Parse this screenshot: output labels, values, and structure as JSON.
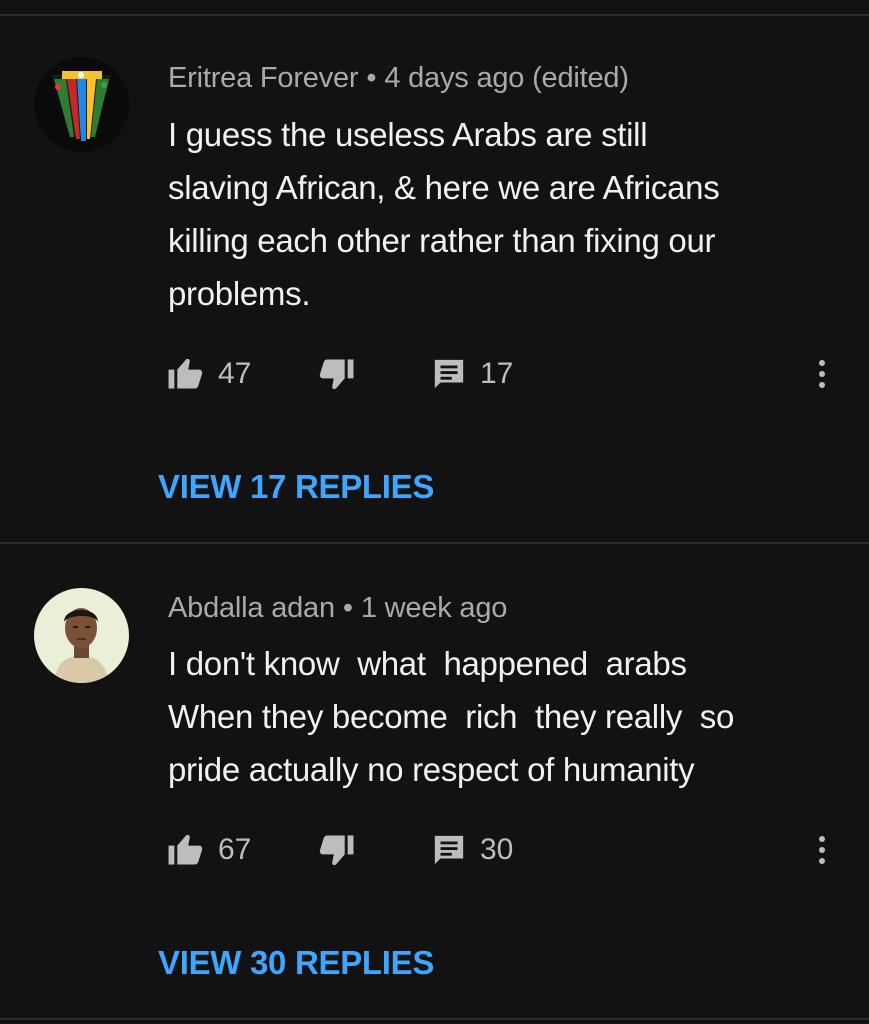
{
  "comments": [
    {
      "author": "Eritrea Forever",
      "separator": "•",
      "time": "4 days ago (edited)",
      "text": "I guess the useless Arabs are still\nslaving African, & here we are Africans\nkilling each other rather than fixing our\nproblems.",
      "likes": "47",
      "reply_count": "17",
      "view_replies": "VIEW 17 REPLIES",
      "avatar_icon": "flag-fan-avatar"
    },
    {
      "author": "Abdalla adan",
      "separator": "•",
      "time": "1 week ago",
      "text": "I don't know  what  happened  arabs\nWhen they become  rich  they really  so\npride actually no respect of humanity",
      "likes": "67",
      "reply_count": "30",
      "view_replies": "VIEW 30 REPLIES",
      "avatar_icon": "person-photo-avatar"
    }
  ],
  "colors": {
    "background": "#121212",
    "link": "#3ea6ff",
    "meta": "#aaaaaa",
    "text": "#f1f1f1",
    "icon": "#bdbdbd"
  }
}
